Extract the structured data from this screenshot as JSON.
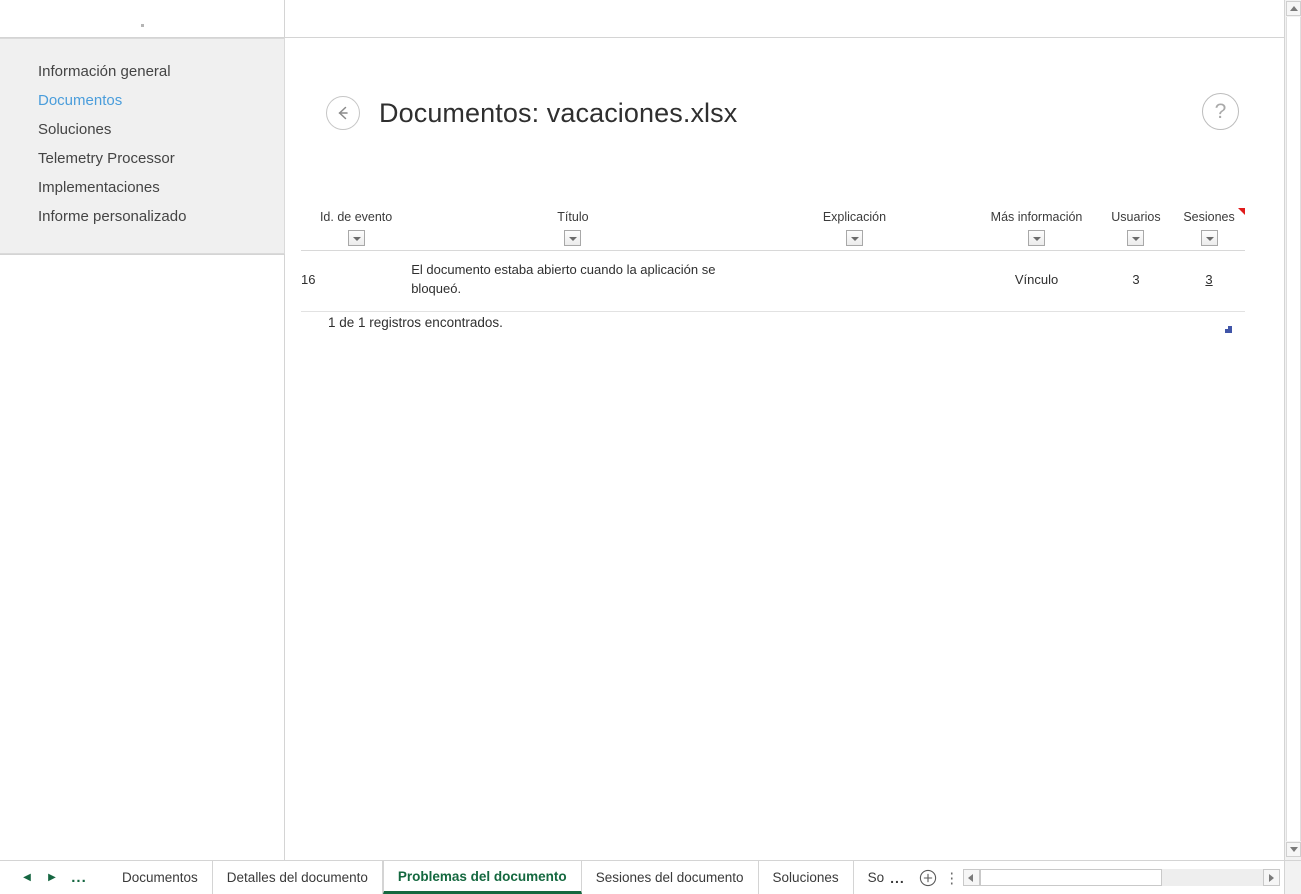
{
  "sidebar": {
    "items": [
      {
        "label": "Información general",
        "active": false
      },
      {
        "label": "Documentos",
        "active": true
      },
      {
        "label": "Soluciones",
        "active": false
      },
      {
        "label": "Telemetry Processor",
        "active": false
      },
      {
        "label": "Implementaciones",
        "active": false
      },
      {
        "label": "Informe personalizado",
        "active": false
      }
    ]
  },
  "header": {
    "back_icon": "back-arrow-icon",
    "title": "Documentos: vacaciones.xlsx",
    "help_label": "?",
    "help_icon": "help-question-icon"
  },
  "table": {
    "columns": [
      {
        "label": "Id. de evento",
        "filter_icon": "filter-dropdown-icon",
        "has_comment_marker": false
      },
      {
        "label": "Título",
        "filter_icon": "filter-dropdown-icon",
        "has_comment_marker": false
      },
      {
        "label": "Explicación",
        "filter_icon": "filter-dropdown-icon",
        "has_comment_marker": false
      },
      {
        "label": "Más información",
        "filter_icon": "filter-dropdown-icon",
        "has_comment_marker": false
      },
      {
        "label": "Usuarios",
        "filter_icon": "filter-dropdown-icon",
        "has_comment_marker": false
      },
      {
        "label": "Sesiones",
        "filter_icon": "filter-dropdown-icon",
        "has_comment_marker": true
      }
    ],
    "rows": [
      {
        "event_id": "16",
        "title": "El documento estaba abierto cuando la aplicación se bloqueó.",
        "explanation": "",
        "more_info": "Vínculo",
        "users": "3",
        "sessions": "3"
      }
    ],
    "footer_text": "1 de 1 registros encontrados."
  },
  "sheet_tabs": {
    "nav": {
      "prev_icon": "nav-prev-arrow-icon",
      "next_icon": "nav-next-arrow-icon",
      "ellipsis": "..."
    },
    "tabs": [
      {
        "label": "Documentos",
        "active": false
      },
      {
        "label": "Detalles del documento",
        "active": false
      },
      {
        "label": "Problemas del documento",
        "active": true
      },
      {
        "label": "Sesiones del documento",
        "active": false
      },
      {
        "label": "Soluciones",
        "active": false
      },
      {
        "label": "So",
        "active": false
      }
    ],
    "overflow_dots": "...",
    "add_sheet_icon": "add-sheet-plus-icon",
    "kebab_icon": "more-options-kebab-icon"
  },
  "scrollbars": {
    "vertical_up_icon": "scroll-up-arrow-icon",
    "vertical_down_icon": "scroll-down-arrow-icon",
    "horizontal_left_icon": "scroll-left-arrow-icon",
    "horizontal_right_icon": "scroll-right-arrow-icon"
  },
  "colors": {
    "accent_green": "#14683f",
    "link_blue": "#4a9ddb",
    "sidebar_bg": "#f0f0f0",
    "comment_red": "#e01b1b",
    "resize_blue": "#4055a8"
  }
}
